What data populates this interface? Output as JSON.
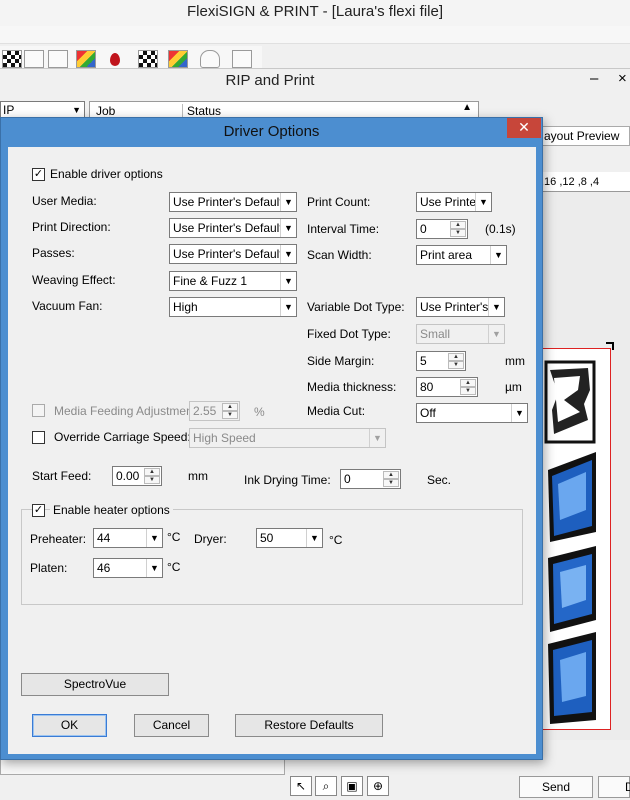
{
  "app": {
    "title": "FlexiSIGN & PRINT - [Laura's flexi file]"
  },
  "rip": {
    "title": "RIP and Print",
    "minimize": "–",
    "close": "×",
    "queue_select": "IP",
    "columns": {
      "job": "Job",
      "status": "Status"
    },
    "layout_preview_tab": "ayout Preview",
    "ruler": ",16  ,12  ,8   ,4",
    "send_label": "Send",
    "d_label": "D"
  },
  "toolbar_icons": [
    "grid-icon",
    "layers-icon",
    "printer-icon",
    "palette-icon",
    "ink-drop-icon",
    "color-bars-icon",
    "color-wheel-icon",
    "cloud-icon",
    "upload-icon"
  ],
  "bottom_tools": [
    "pointer-icon",
    "zoom-icon",
    "image-icon",
    "zoom-fit-icon"
  ],
  "dialog": {
    "title": "Driver Options",
    "close_glyph": "✕",
    "enable_driver_options": {
      "label": "Enable driver options",
      "checked": true
    },
    "left_fields": [
      {
        "label": "User Media:",
        "value": "Use Printer's Default"
      },
      {
        "label": "Print Direction:",
        "value": "Use Printer's Default"
      },
      {
        "label": "Passes:",
        "value": "Use Printer's Default"
      },
      {
        "label": "Weaving Effect:",
        "value": "Fine & Fuzz 1"
      },
      {
        "label": "Vacuum Fan:",
        "value": "High"
      }
    ],
    "print_count": {
      "label": "Print Count:",
      "value": "Use Printer"
    },
    "interval_time": {
      "label": "Interval Time:",
      "value": "0",
      "unit": "(0.1s)"
    },
    "scan_width": {
      "label": "Scan Width:",
      "value": "Print area"
    },
    "variable_dot_type": {
      "label": "Variable Dot Type:",
      "value": "Use Printer's D"
    },
    "fixed_dot_type": {
      "label": "Fixed Dot Type:",
      "value": "Small"
    },
    "side_margin": {
      "label": "Side Margin:",
      "value": "5",
      "unit": "mm"
    },
    "media_thickness": {
      "label": "Media thickness:",
      "value": "80",
      "unit": "µm"
    },
    "media_cut": {
      "label": "Media Cut:",
      "value": "Off"
    },
    "media_feeding_adjustment": {
      "label": "Media Feeding Adjustment:",
      "value": "2.55",
      "unit": "%",
      "checked": false
    },
    "override_carriage_speed": {
      "label": "Override Carriage Speed:",
      "value": "High Speed",
      "checked": false
    },
    "start_feed": {
      "label": "Start Feed:",
      "value": "0.00",
      "unit": "mm"
    },
    "ink_drying_time": {
      "label": "Ink Drying Time:",
      "value": "0",
      "unit": "Sec."
    },
    "heater": {
      "enable_label": "Enable heater options",
      "checked": true,
      "preheater": {
        "label": "Preheater:",
        "value": "44",
        "unit": "°C"
      },
      "dryer": {
        "label": "Dryer:",
        "value": "50",
        "unit": "°C"
      },
      "platen": {
        "label": "Platen:",
        "value": "46",
        "unit": "°C"
      }
    },
    "buttons": {
      "spectrovue": "SpectroVue",
      "ok": "OK",
      "cancel": "Cancel",
      "restore_defaults": "Restore Defaults"
    }
  }
}
